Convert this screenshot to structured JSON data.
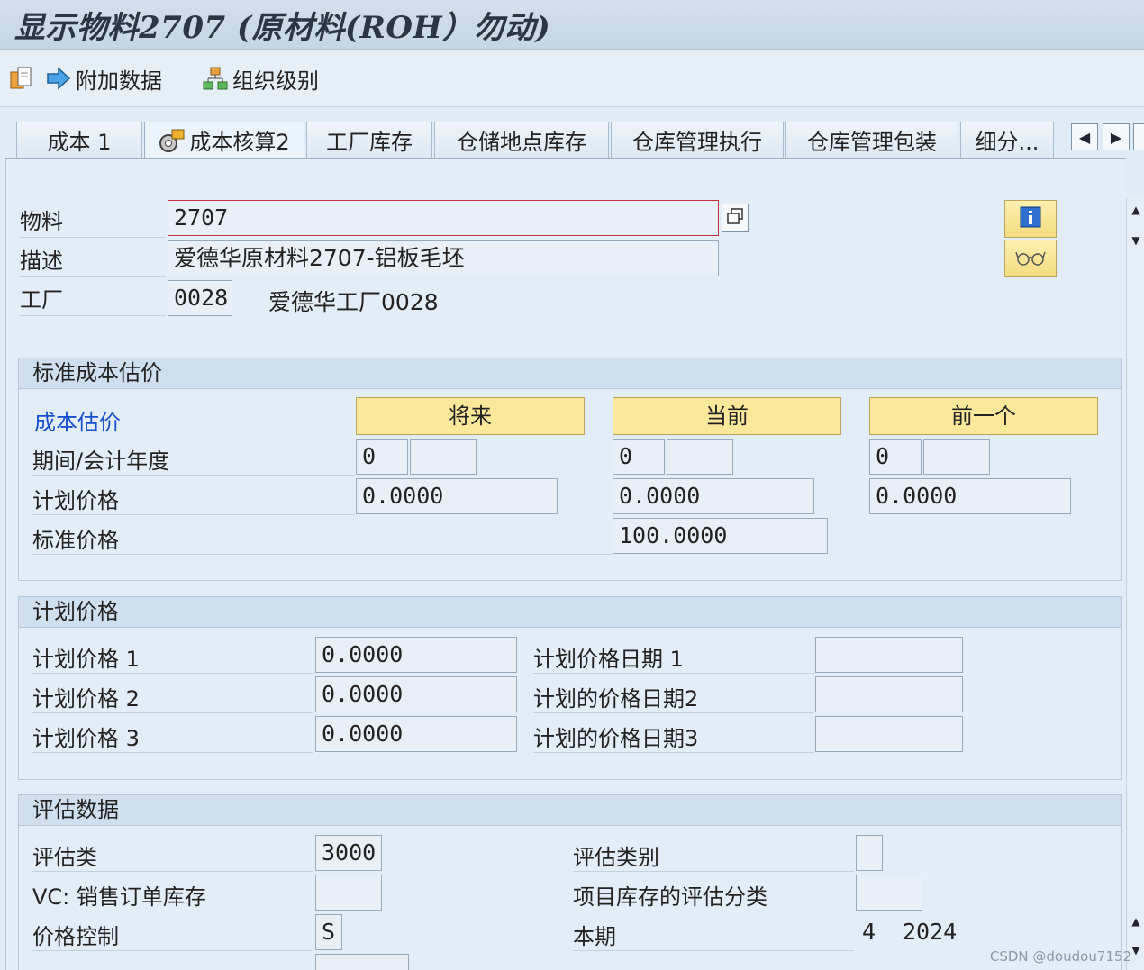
{
  "title": "显示物料2707 (原材料(ROH）勿动)",
  "toolbar": {
    "additional_data": "附加数据",
    "org_levels": "组织级别"
  },
  "tabs": [
    "成本 1",
    "成本核算2",
    "工厂库存",
    "仓储地点库存",
    "仓库管理执行",
    "仓库管理包装",
    "细分..."
  ],
  "header": {
    "material_label": "物料",
    "material_value": "2707",
    "description_label": "描述",
    "description_value": "爱德华原材料2707-铝板毛坯",
    "plant_label": "工厂",
    "plant_value": "0028",
    "plant_name": "爱德华工厂0028"
  },
  "std_cost": {
    "heading": "标准成本估价",
    "cost_estimate_label": "成本估价",
    "col_future": "将来",
    "col_current": "当前",
    "col_previous": "前一个",
    "period_label": "期间/会计年度",
    "planned_price_label": "计划价格",
    "standard_price_label": "标准价格",
    "future_period": "0",
    "future_year": "",
    "future_planned": "0.0000",
    "current_period": "0",
    "current_year": "",
    "current_planned": "0.0000",
    "current_standard": "100.0000",
    "previous_period": "0",
    "previous_year": "",
    "previous_planned": "0.0000"
  },
  "planned_prices": {
    "heading": "计划价格",
    "p1_label": "计划价格 1",
    "p1_value": "0.0000",
    "p2_label": "计划价格 2",
    "p2_value": "0.0000",
    "p3_label": "计划价格 3",
    "p3_value": "0.0000",
    "d1_label": "计划价格日期 1",
    "d1_value": "",
    "d2_label": "计划的价格日期2",
    "d2_value": "",
    "d3_label": "计划的价格日期3",
    "d3_value": ""
  },
  "valuation": {
    "heading": "评估数据",
    "class_label": "评估类",
    "class_value": "3000",
    "vc_label": "VC: 销售订单库存",
    "vc_value": "",
    "price_control_label": "价格控制",
    "price_control_value": "S",
    "category_label": "评估类别",
    "category_value": "",
    "project_label": "项目库存的评估分类",
    "project_value": "",
    "period_label": "本期",
    "period_month": "4",
    "period_year": "2024"
  },
  "watermark": "CSDN @doudou7152",
  "colors": {
    "accent_yellow": "#fbe89a",
    "link_blue": "#1a4fd0",
    "panel_bg": "#e2edf7"
  }
}
